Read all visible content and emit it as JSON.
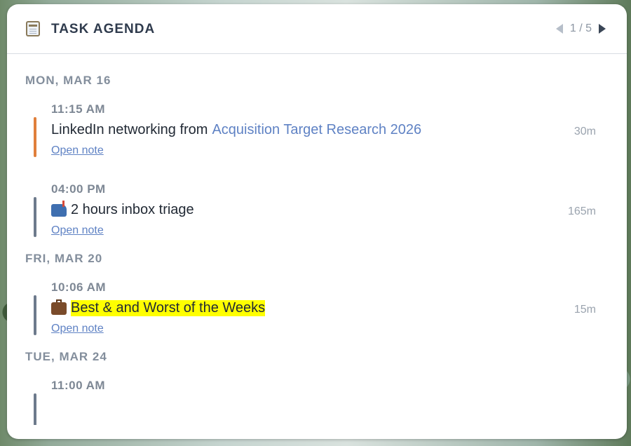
{
  "header": {
    "title": "TASK AGENDA",
    "page_indicator": "1 / 5",
    "icon": "notepad-icon"
  },
  "groups": [
    {
      "date": "MON, MAR 16",
      "tasks": [
        {
          "time": "11:15 AM",
          "title": "LinkedIn networking from",
          "link": "Acquisition Target Research 2026",
          "duration": "30m",
          "open_label": "Open note",
          "color": "#e07f3b",
          "emoji": ""
        },
        {
          "time": "04:00 PM",
          "title": "2 hours inbox triage",
          "link": "",
          "duration": "165m",
          "open_label": "Open note",
          "color": "#6d7a8c",
          "emoji": "mailbox-icon"
        }
      ]
    },
    {
      "date": "FRI, MAR 20",
      "tasks": [
        {
          "time": "10:06 AM",
          "title": "Best & and Worst of the Weeks",
          "link": "",
          "duration": "15m",
          "open_label": "Open note",
          "color": "#6d7a8c",
          "emoji": "briefcase-icon",
          "highlight": true
        }
      ]
    },
    {
      "date": "TUE, MAR 24",
      "tasks": [
        {
          "time": "11:00 AM",
          "title": "",
          "link": "",
          "duration": "",
          "open_label": "",
          "color": "#6d7a8c",
          "emoji": ""
        }
      ]
    }
  ]
}
